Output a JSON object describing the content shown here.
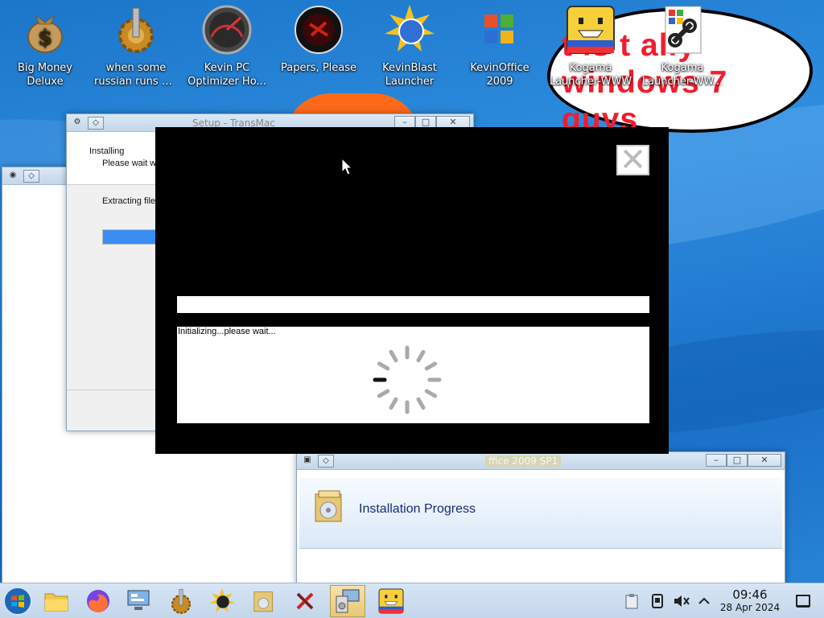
{
  "desktop": {
    "icons": [
      {
        "name": "money-bag-icon",
        "label": "Big Money\nDeluxe"
      },
      {
        "name": "factory-gear-icon",
        "label": "when some\nrussian runs a..."
      },
      {
        "name": "gauge-icon",
        "label": "Kevin PC\nOptimizer Ho..."
      },
      {
        "name": "red-seal-icon",
        "label": "Papers, Please"
      },
      {
        "name": "sun-globe-icon",
        "label": "KevinBlast\nLauncher"
      },
      {
        "name": "office-logo-icon",
        "label": "KevinOffice\n2009"
      },
      {
        "name": "kogama-face-icon",
        "label": "Kogama\nLauncher-WWW"
      },
      {
        "name": "shortcut-link-icon",
        "label": "Kogama\nLauncher-WW..."
      }
    ],
    "bubble": {
      "line1": "t   is t   ally",
      "line2": "windows 7 guys"
    }
  },
  "windows": {
    "setup": {
      "title": "Setup - TransMac",
      "heading": "Installing",
      "subheading": "Please wait w",
      "extracting": "Extracting file"
    },
    "office": {
      "title": "ffice 2009 SP1",
      "heading": "Installation Progress"
    }
  },
  "popup": {
    "close_glyph": "✕",
    "status": "Initializing...please wait..."
  },
  "taskbar": {
    "start_icon": "windows-start-icon",
    "items": [
      "file-explorer-icon",
      "firefox-icon",
      "control-panel-icon",
      "factory-gear-icon",
      "sun-globe-icon",
      "installer-box-icon",
      "xtool-icon",
      "setup-computer-icon",
      "kogama-face-icon"
    ],
    "clock": {
      "time": "09:46",
      "date": "28 Apr 2024"
    }
  }
}
